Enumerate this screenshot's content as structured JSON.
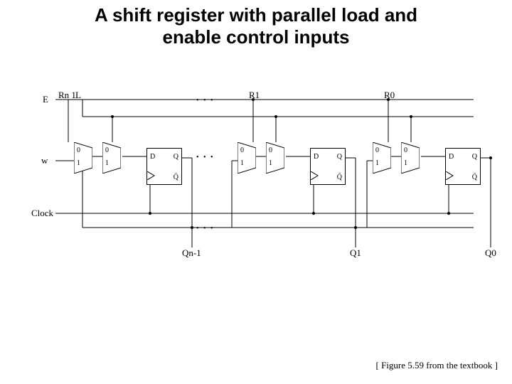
{
  "title_line1": "A shift register with parallel load and",
  "title_line2": "enable control inputs",
  "caption": "[ Figure 5.59 from the textbook ]",
  "labels": {
    "E": "E",
    "Rn1": "Rn 1",
    "L": "L",
    "R1": "R1",
    "R0": "R0",
    "w": "w",
    "Clock": "Clock",
    "Qn1": "Qn-1",
    "Q1": "Q1",
    "Q0": "Q0",
    "D": "D",
    "Q": "Q",
    "Qbar": "Q̄",
    "m0": "0",
    "m1": "1"
  }
}
